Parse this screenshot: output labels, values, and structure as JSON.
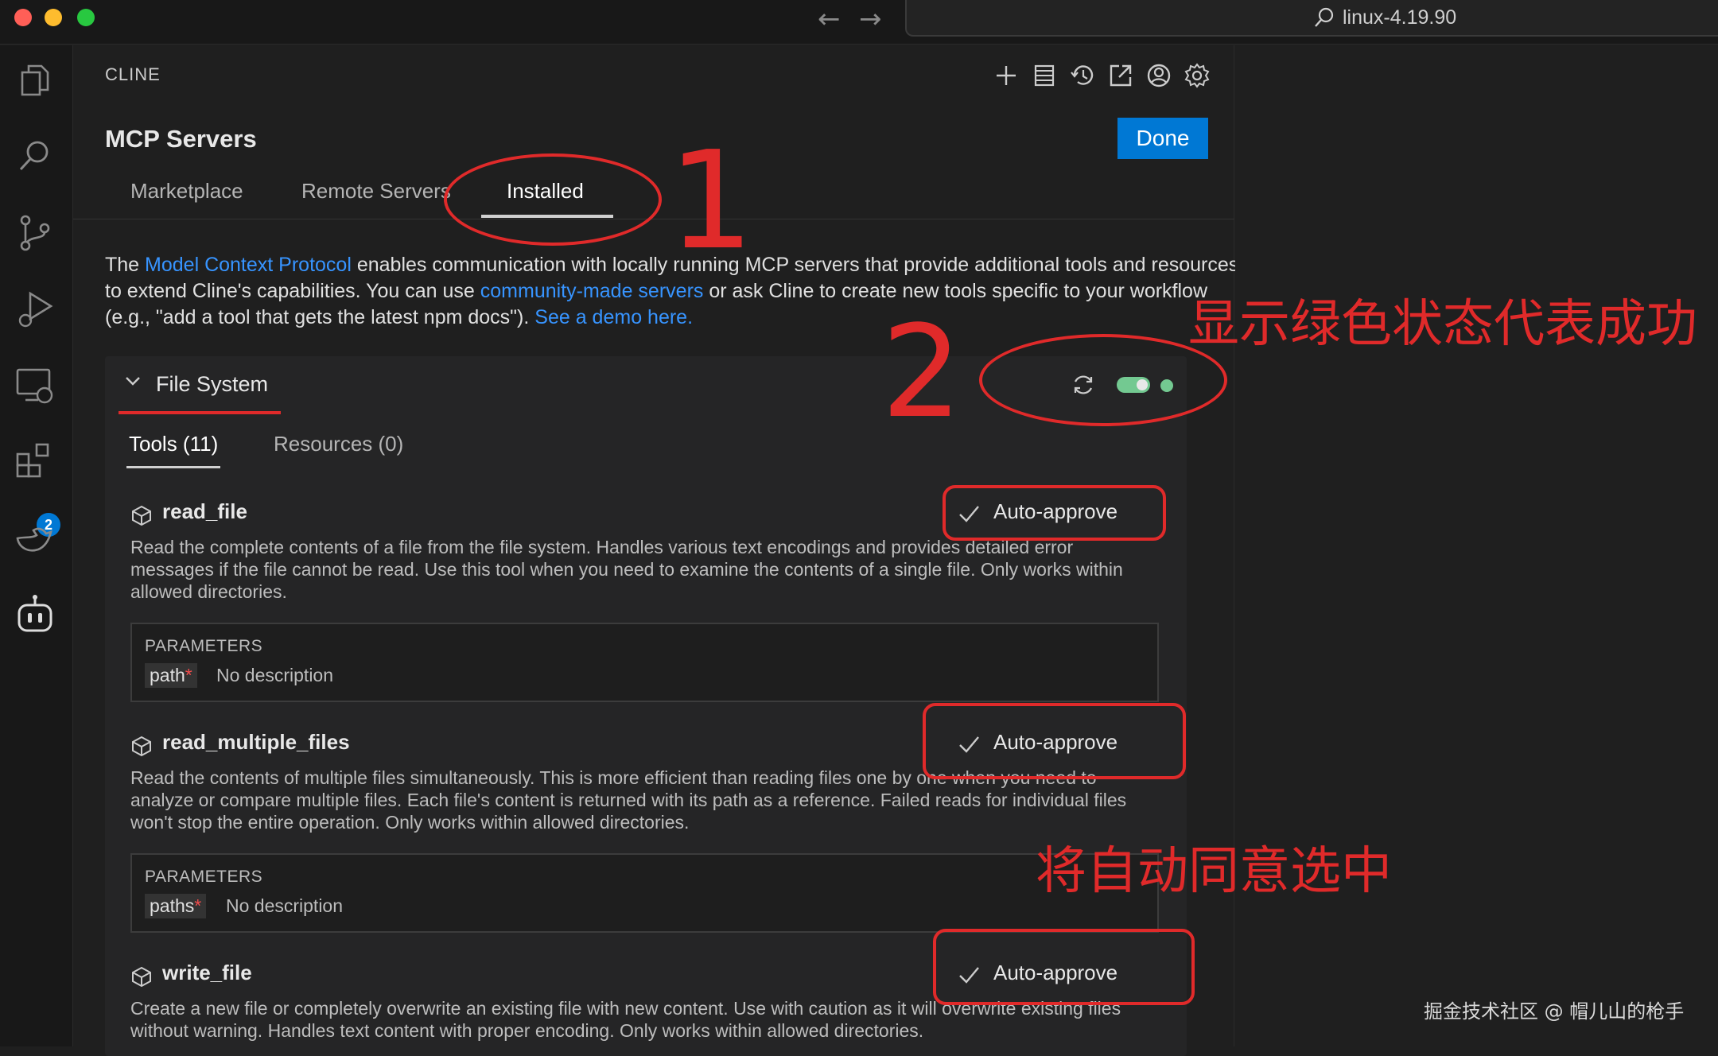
{
  "titlebar": {
    "search_text": "linux-4.19.90"
  },
  "activity": {
    "extensions_badge": "2"
  },
  "panel": {
    "title": "CLINE",
    "heading": "MCP Servers",
    "done_label": "Done",
    "tabs": [
      {
        "label": "Marketplace"
      },
      {
        "label": "Remote Servers"
      },
      {
        "label": "Installed"
      }
    ],
    "intro": {
      "p1": "The ",
      "link1": "Model Context Protocol",
      "p2": " enables communication with locally running MCP servers that provide additional tools and resources to extend Cline's capabilities. You can use ",
      "link2": "community-made servers",
      "p3": " or ask Cline to create new tools specific to your workflow (e.g., \"add a tool that gets the latest npm docs\"). ",
      "link3": "See a demo here."
    }
  },
  "server": {
    "name": "File System",
    "enabled": true,
    "status_color": "#73c991",
    "subtabs": [
      {
        "label": "Tools (11)"
      },
      {
        "label": "Resources (0)"
      }
    ],
    "params_title": "PARAMETERS",
    "auto_label": "Auto-approve",
    "tools": [
      {
        "name": "read_file",
        "desc": "Read the complete contents of a file from the file system. Handles various text encodings and provides detailed error messages if the file cannot be read. Use this tool when you need to examine the contents of a single file. Only works within allowed directories.",
        "param": "path",
        "param_desc": "No description"
      },
      {
        "name": "read_multiple_files",
        "desc": "Read the contents of multiple files simultaneously. This is more efficient than reading files one by one when you need to analyze or compare multiple files. Each file's content is returned with its path as a reference. Failed reads for individual files won't stop the entire operation. Only works within allowed directories.",
        "param": "paths",
        "param_desc": "No description"
      },
      {
        "name": "write_file",
        "desc": "Create a new file or completely overwrite an existing file with new content. Use with caution as it will overwrite existing files without warning. Handles text content with proper encoding. Only works within allowed directories."
      }
    ]
  },
  "annotations": {
    "num1": "1",
    "num2": "2",
    "note_status": "显示绿色状态代表成功",
    "note_auto": "将自动同意选中",
    "watermark": "掘金技术社区 @ 帽儿山的枪手"
  },
  "colors": {
    "accent": "#0078d4",
    "link": "#3794ff",
    "annotation": "#e02a2a"
  }
}
